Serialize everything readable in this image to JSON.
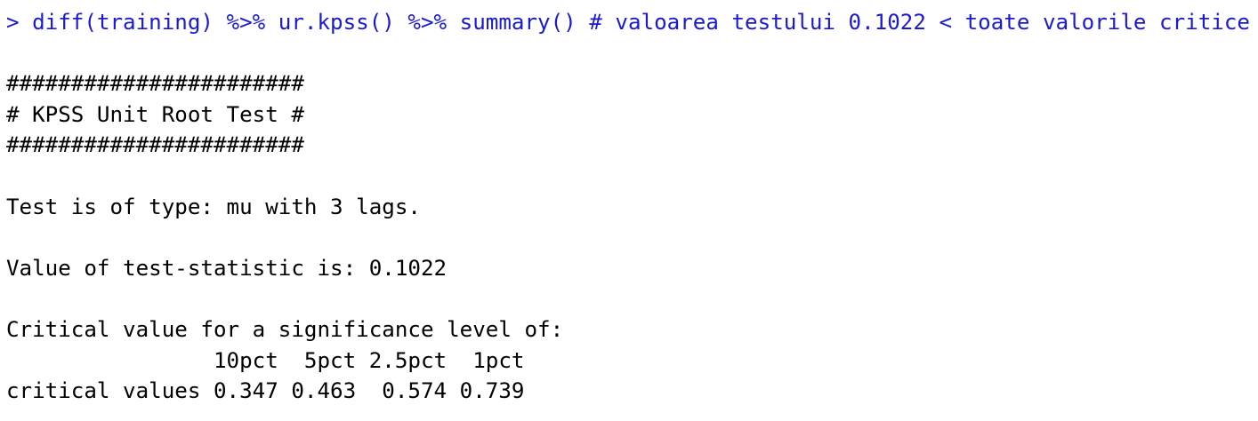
{
  "console": {
    "input": {
      "prompt": "> ",
      "command": "diff(training) %>% ur.kpss() %>% summary() # valoarea testului 0.1022 < toate valorile critice",
      "color": "#1a1ad6"
    },
    "output": {
      "border_top": "#######################",
      "title": "# KPSS Unit Root Test #",
      "border_bottom": "#######################",
      "test_type": "Test is of type: mu with 3 lags.",
      "statistic": "Value of test-statistic is: 0.1022",
      "critical_heading": "Critical value for a significance level of:",
      "table_header": "                10pct  5pct 2.5pct  1pct",
      "table_row": "critical values 0.347 0.463  0.574 0.739"
    }
  }
}
